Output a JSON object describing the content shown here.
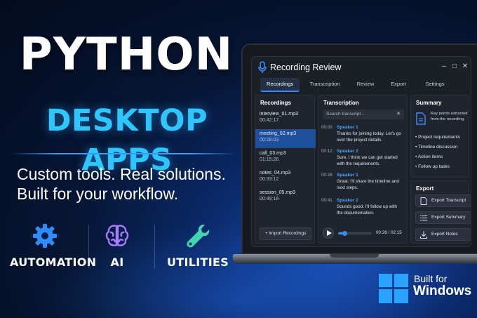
{
  "promo": {
    "headline_line1": "PYTHON",
    "headline_line2": "DESKTOP APPS",
    "tagline_line1": "Custom tools. Real solutions.",
    "tagline_line2": "Built for your workflow.",
    "features": [
      {
        "label": "AUTOMATION",
        "icon": "gear-icon"
      },
      {
        "label": "AI",
        "icon": "brain-icon"
      },
      {
        "label": "UTILITIES",
        "icon": "wrench-icon"
      }
    ],
    "badge_line1": "Built for",
    "badge_line2": "Windows",
    "badge_icon": "windows-logo-icon"
  },
  "app": {
    "title": "Recording Review",
    "window_controls": [
      "–",
      "□",
      "✕"
    ],
    "tabs": [
      "Recordings",
      "Transcription",
      "Review",
      "Export",
      "Settings"
    ],
    "active_tab": "Recordings",
    "recordings": {
      "title": "Recordings",
      "items": [
        {
          "name": "interview_01.mp3",
          "duration": "00:42:17"
        },
        {
          "name": "meeting_02.mp3",
          "duration": "00:28:03"
        },
        {
          "name": "call_03.mp3",
          "duration": "01:15:26"
        },
        {
          "name": "notes_04.mp3",
          "duration": "00:33:12"
        },
        {
          "name": "session_05.mp3",
          "duration": "00:49:18"
        }
      ],
      "selected_index": 1,
      "import_label": "+ Import Recordings"
    },
    "transcription": {
      "title": "Transcription",
      "search_placeholder": "Search transcript...",
      "search_clear": "✕",
      "entries": [
        {
          "time": "00:00",
          "speaker": "Speaker 1",
          "text": "Thanks for joining today. Let's go over the project details."
        },
        {
          "time": "00:12",
          "speaker": "Speaker 2",
          "text": "Sure, I think we can get started with the requirements."
        },
        {
          "time": "00:28",
          "speaker": "Speaker 1",
          "text": "Great. I'll share the timeline and next steps."
        },
        {
          "time": "00:41",
          "speaker": "Speaker 2",
          "text": "Sounds good. I'll follow up with the documentation."
        }
      ],
      "player_time": "00:28 / 02:15",
      "progress": 0.2
    },
    "summary": {
      "title": "Summary",
      "intro": "Key points extracted from the recording.",
      "bullets": [
        "• Project requirements",
        "• Timeline discussion",
        "• Action items",
        "• Follow up tasks"
      ]
    },
    "export": {
      "title": "Export",
      "buttons": [
        {
          "label": "Export Transcript",
          "icon": "document-icon"
        },
        {
          "label": "Export Summary",
          "icon": "list-icon"
        },
        {
          "label": "Export Notes",
          "icon": "download-icon"
        }
      ]
    }
  },
  "colors": {
    "accent_cyan": "#2fc6ff",
    "accent_blue": "#3a8dff",
    "gear": "#2f8cff",
    "brain": "#a87cff",
    "wrench": "#3fd6b0",
    "windows": "#2aa3ff"
  }
}
